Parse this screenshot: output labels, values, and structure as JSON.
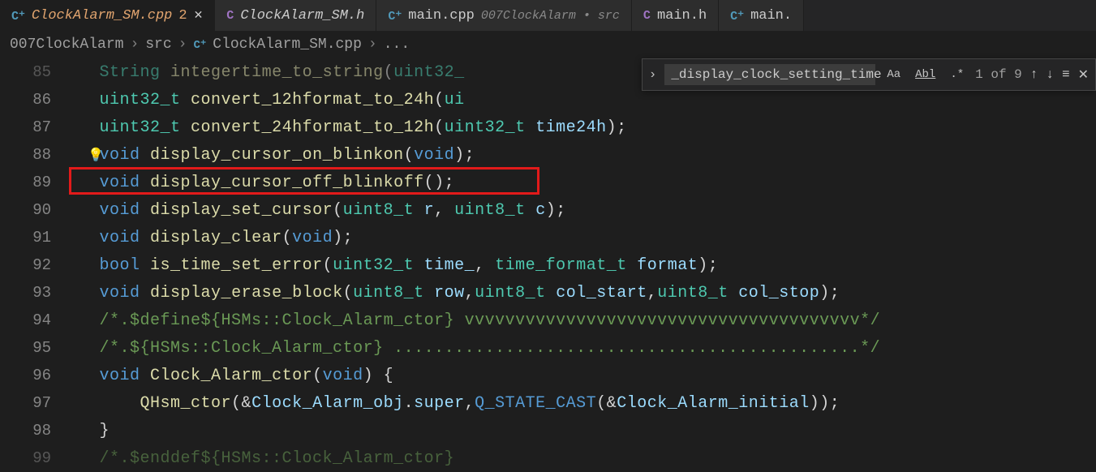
{
  "tabs": [
    {
      "icon": "cpp",
      "name": "ClockAlarm_SM.cpp",
      "badge": "2",
      "active": true,
      "modified": true
    },
    {
      "icon": "c",
      "name": "ClockAlarm_SM.h",
      "italic": true
    },
    {
      "icon": "cpp",
      "name": "main.cpp",
      "desc": "007ClockAlarm • src"
    },
    {
      "icon": "c",
      "name": "main.h"
    },
    {
      "icon": "cpp",
      "name": "main."
    }
  ],
  "breadcrumb": {
    "parts": [
      "007ClockAlarm",
      "src",
      "ClockAlarm_SM.cpp",
      "..."
    ],
    "icon_before_index": 2
  },
  "find": {
    "query": "_display_clock_setting_time",
    "count": "1 of 9",
    "opts": [
      "Aa",
      "Abl",
      ".*"
    ]
  },
  "lines": [
    {
      "n": 85,
      "dim": true,
      "tokens": [
        [
          "type",
          "String"
        ],
        [
          "op",
          " "
        ],
        [
          "fn",
          "integertime_to_string"
        ],
        [
          "pun",
          "("
        ],
        [
          "type",
          "uint32_"
        ]
      ]
    },
    {
      "n": 86,
      "tokens": [
        [
          "type",
          "uint32_t"
        ],
        [
          "op",
          " "
        ],
        [
          "fn",
          "convert_12hformat_to_24h"
        ],
        [
          "pun",
          "("
        ],
        [
          "type",
          "ui"
        ]
      ]
    },
    {
      "n": 87,
      "tokens": [
        [
          "type",
          "uint32_t"
        ],
        [
          "op",
          " "
        ],
        [
          "fn",
          "convert_24hformat_to_12h"
        ],
        [
          "pun",
          "("
        ],
        [
          "type",
          "uint32_t"
        ],
        [
          "op",
          " "
        ],
        [
          "param",
          "time24h"
        ],
        [
          "pun",
          ");"
        ]
      ]
    },
    {
      "n": 88,
      "bulb": true,
      "tokens": [
        [
          "kw",
          "void"
        ],
        [
          "op",
          " "
        ],
        [
          "fn",
          "display_cursor_on_blinkon"
        ],
        [
          "pun",
          "("
        ],
        [
          "kw",
          "void"
        ],
        [
          "pun",
          ");"
        ]
      ]
    },
    {
      "n": 89,
      "boxed": true,
      "tokens": [
        [
          "kw",
          "void"
        ],
        [
          "op",
          " "
        ],
        [
          "fn",
          "display_cursor_off_blinkoff"
        ],
        [
          "pun",
          "();"
        ]
      ]
    },
    {
      "n": 90,
      "tokens": [
        [
          "kw",
          "void"
        ],
        [
          "op",
          " "
        ],
        [
          "fn",
          "display_set_cursor"
        ],
        [
          "pun",
          "("
        ],
        [
          "type",
          "uint8_t"
        ],
        [
          "op",
          " "
        ],
        [
          "param",
          "r"
        ],
        [
          "pun",
          ", "
        ],
        [
          "type",
          "uint8_t"
        ],
        [
          "op",
          " "
        ],
        [
          "param",
          "c"
        ],
        [
          "pun",
          ");"
        ]
      ]
    },
    {
      "n": 91,
      "tokens": [
        [
          "kw",
          "void"
        ],
        [
          "op",
          " "
        ],
        [
          "fn",
          "display_clear"
        ],
        [
          "pun",
          "("
        ],
        [
          "kw",
          "void"
        ],
        [
          "pun",
          ");"
        ]
      ]
    },
    {
      "n": 92,
      "tokens": [
        [
          "kw",
          "bool"
        ],
        [
          "op",
          " "
        ],
        [
          "fn",
          "is_time_set_error"
        ],
        [
          "pun",
          "("
        ],
        [
          "type",
          "uint32_t"
        ],
        [
          "op",
          " "
        ],
        [
          "param",
          "time_"
        ],
        [
          "pun",
          ", "
        ],
        [
          "type",
          "time_format_t"
        ],
        [
          "op",
          " "
        ],
        [
          "param",
          "format"
        ],
        [
          "pun",
          ");"
        ]
      ]
    },
    {
      "n": 93,
      "tokens": [
        [
          "kw",
          "void"
        ],
        [
          "op",
          " "
        ],
        [
          "fn",
          "display_erase_block"
        ],
        [
          "pun",
          "("
        ],
        [
          "type",
          "uint8_t"
        ],
        [
          "op",
          " "
        ],
        [
          "param",
          "row"
        ],
        [
          "pun",
          ","
        ],
        [
          "type",
          "uint8_t"
        ],
        [
          "op",
          " "
        ],
        [
          "param",
          "col_start"
        ],
        [
          "pun",
          ","
        ],
        [
          "type",
          "uint8_t"
        ],
        [
          "op",
          " "
        ],
        [
          "param",
          "col_stop"
        ],
        [
          "pun",
          ");"
        ]
      ]
    },
    {
      "n": 94,
      "tokens": [
        [
          "comment",
          "/*.$define${HSMs::Clock_Alarm_ctor} vvvvvvvvvvvvvvvvvvvvvvvvvvvvvvvvvvvvvvv*/"
        ]
      ]
    },
    {
      "n": 95,
      "tokens": [
        [
          "comment",
          "/*.${HSMs::Clock_Alarm_ctor} ..............................................*/"
        ]
      ]
    },
    {
      "n": 96,
      "tokens": [
        [
          "kw",
          "void"
        ],
        [
          "op",
          " "
        ],
        [
          "fn",
          "Clock_Alarm_ctor"
        ],
        [
          "pun",
          "("
        ],
        [
          "kw",
          "void"
        ],
        [
          "pun",
          ") {"
        ]
      ]
    },
    {
      "n": 97,
      "indent": 1,
      "tokens": [
        [
          "fn",
          "QHsm_ctor"
        ],
        [
          "pun",
          "(&"
        ],
        [
          "param",
          "Clock_Alarm_obj"
        ],
        [
          "pun",
          "."
        ],
        [
          "param",
          "super"
        ],
        [
          "pun",
          ","
        ],
        [
          "macro",
          "Q_STATE_CAST"
        ],
        [
          "pun",
          "(&"
        ],
        [
          "param",
          "Clock_Alarm_initial"
        ],
        [
          "pun",
          "));"
        ]
      ]
    },
    {
      "n": 98,
      "tokens": [
        [
          "pun",
          "}"
        ]
      ]
    },
    {
      "n": 99,
      "dim": true,
      "tokens": [
        [
          "comment",
          "/*.$enddef${HSMs::Clock_Alarm_ctor} "
        ]
      ]
    }
  ]
}
